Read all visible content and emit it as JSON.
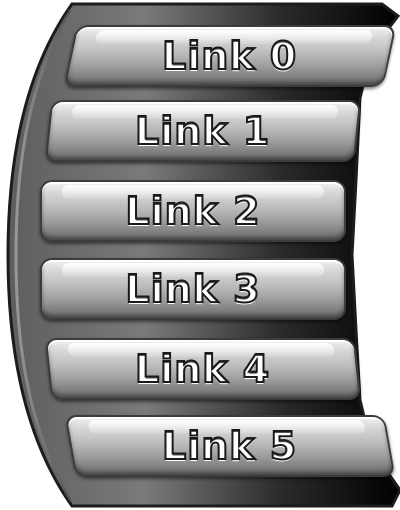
{
  "menu": {
    "links": [
      {
        "label": "Link 0"
      },
      {
        "label": "Link 1"
      },
      {
        "label": "Link 2"
      },
      {
        "label": "Link 3"
      },
      {
        "label": "Link 4"
      },
      {
        "label": "Link 5"
      }
    ]
  },
  "colors": {
    "backplate_dark": "#1a1a1a",
    "backplate_mid": "#6a6a6a",
    "button_light": "#d8d8d8",
    "button_dark": "#7d7d7d",
    "outline": "#1a1a1a"
  }
}
